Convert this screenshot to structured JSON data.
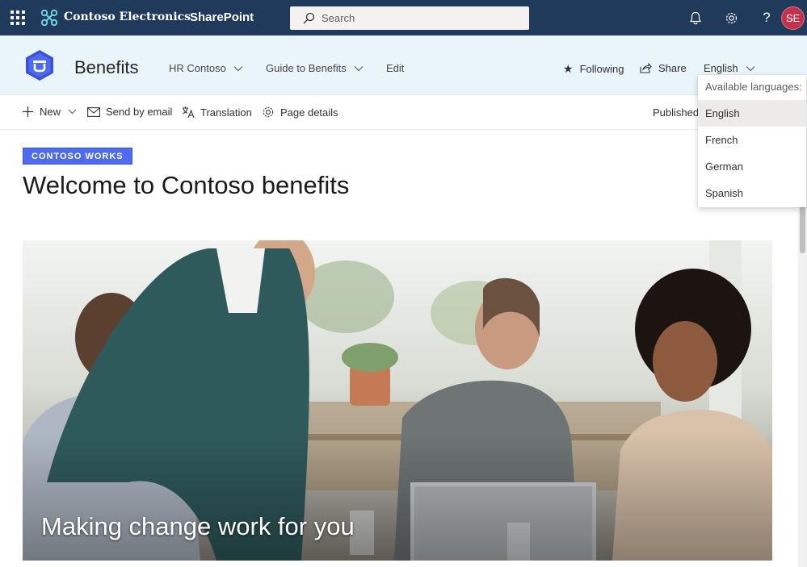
{
  "suite_bar": {
    "org_name": "Contoso Electronics",
    "app_name": "SharePoint",
    "search_placeholder": "Search",
    "avatar_initials": "SE",
    "icons": [
      "app-launcher-icon",
      "bell-icon",
      "gear-icon",
      "help-icon"
    ]
  },
  "site_header": {
    "title": "Benefits",
    "nav": [
      {
        "label": "HR Contoso"
      },
      {
        "label": "Guide to Benefits"
      },
      {
        "label": "Edit"
      }
    ],
    "following_label": "Following",
    "share_label": "Share",
    "language_label": "English"
  },
  "command_bar": {
    "new_label": "New",
    "send_email_label": "Send by email",
    "translation_label": "Translation",
    "page_details_label": "Page details",
    "status_label": "Published"
  },
  "page": {
    "topic_tag": "CONTOSO WORKS",
    "title": "Welcome to Contoso benefits",
    "hero_caption": "Making change work for you"
  },
  "language_menu": {
    "header": "Available languages:",
    "options": [
      "English",
      "French",
      "German",
      "Spanish"
    ],
    "selected": "English"
  },
  "colors": {
    "suite_bar": "#1f3a5a",
    "header_bg": "#e9f5f9",
    "topic_tag": "#4f6bed",
    "avatar": "#c4314b"
  }
}
